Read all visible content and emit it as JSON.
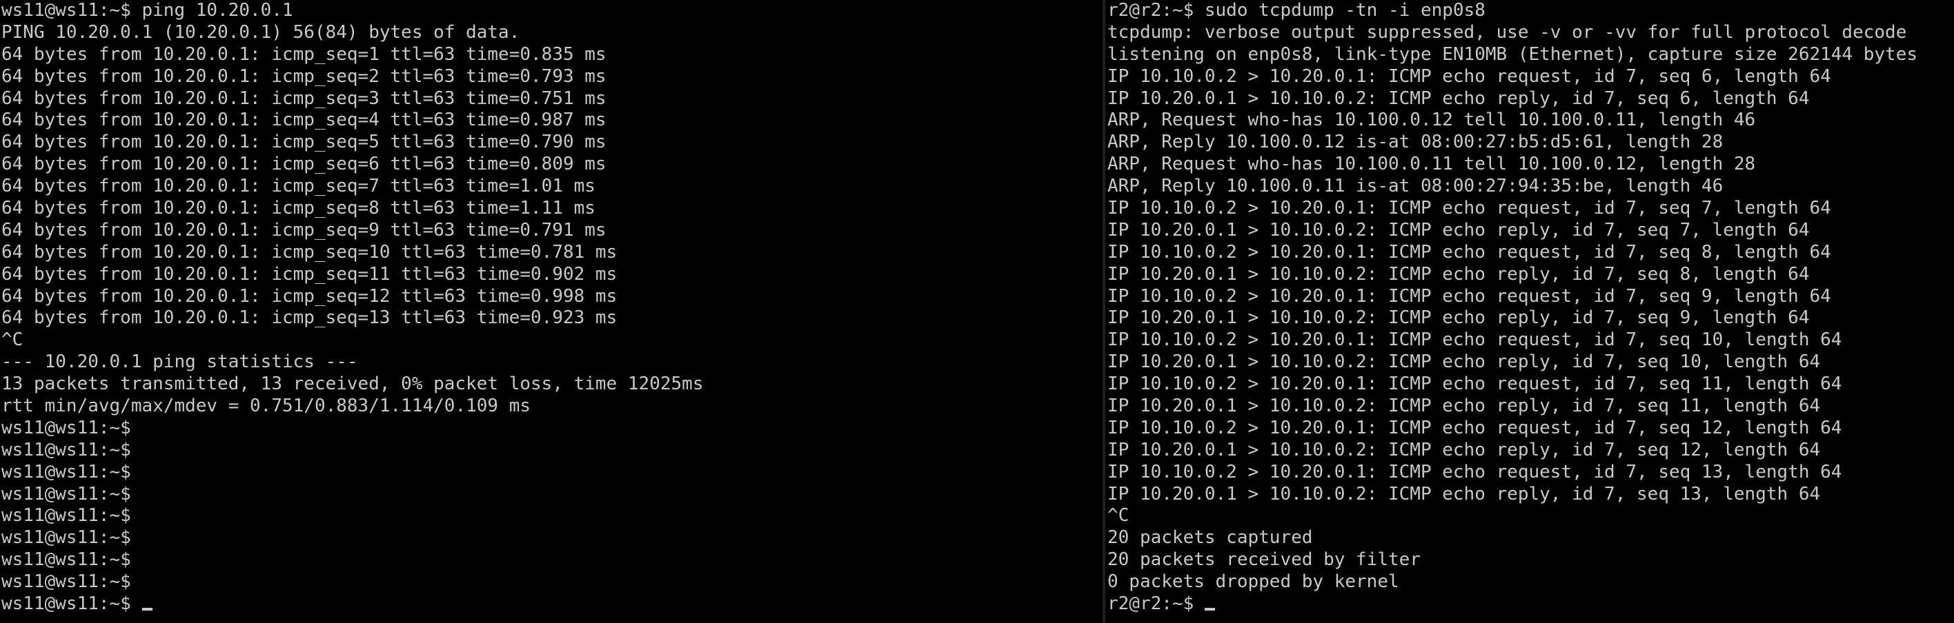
{
  "colors": {
    "background": "#000000",
    "text": "#c8c8c8",
    "divider": "#202020"
  },
  "left_terminal": {
    "lines": [
      "ws11@ws11:~$ ping 10.20.0.1",
      "PING 10.20.0.1 (10.20.0.1) 56(84) bytes of data.",
      "64 bytes from 10.20.0.1: icmp_seq=1 ttl=63 time=0.835 ms",
      "64 bytes from 10.20.0.1: icmp_seq=2 ttl=63 time=0.793 ms",
      "64 bytes from 10.20.0.1: icmp_seq=3 ttl=63 time=0.751 ms",
      "64 bytes from 10.20.0.1: icmp_seq=4 ttl=63 time=0.987 ms",
      "64 bytes from 10.20.0.1: icmp_seq=5 ttl=63 time=0.790 ms",
      "64 bytes from 10.20.0.1: icmp_seq=6 ttl=63 time=0.809 ms",
      "64 bytes from 10.20.0.1: icmp_seq=7 ttl=63 time=1.01 ms",
      "64 bytes from 10.20.0.1: icmp_seq=8 ttl=63 time=1.11 ms",
      "64 bytes from 10.20.0.1: icmp_seq=9 ttl=63 time=0.791 ms",
      "64 bytes from 10.20.0.1: icmp_seq=10 ttl=63 time=0.781 ms",
      "64 bytes from 10.20.0.1: icmp_seq=11 ttl=63 time=0.902 ms",
      "64 bytes from 10.20.0.1: icmp_seq=12 ttl=63 time=0.998 ms",
      "64 bytes from 10.20.0.1: icmp_seq=13 ttl=63 time=0.923 ms",
      "^C",
      "--- 10.20.0.1 ping statistics ---",
      "13 packets transmitted, 13 received, 0% packet loss, time 12025ms",
      "rtt min/avg/max/mdev = 0.751/0.883/1.114/0.109 ms",
      "ws11@ws11:~$",
      "ws11@ws11:~$",
      "ws11@ws11:~$",
      "ws11@ws11:~$",
      "ws11@ws11:~$",
      "ws11@ws11:~$",
      "ws11@ws11:~$",
      "ws11@ws11:~$"
    ],
    "prompt": "ws11@ws11:~$ "
  },
  "right_terminal": {
    "lines": [
      "r2@r2:~$ sudo tcpdump -tn -i enp0s8",
      "tcpdump: verbose output suppressed, use -v or -vv for full protocol decode",
      "listening on enp0s8, link-type EN10MB (Ethernet), capture size 262144 bytes",
      "IP 10.10.0.2 > 10.20.0.1: ICMP echo request, id 7, seq 6, length 64",
      "IP 10.20.0.1 > 10.10.0.2: ICMP echo reply, id 7, seq 6, length 64",
      "ARP, Request who-has 10.100.0.12 tell 10.100.0.11, length 46",
      "ARP, Reply 10.100.0.12 is-at 08:00:27:b5:d5:61, length 28",
      "ARP, Request who-has 10.100.0.11 tell 10.100.0.12, length 28",
      "ARP, Reply 10.100.0.11 is-at 08:00:27:94:35:be, length 46",
      "IP 10.10.0.2 > 10.20.0.1: ICMP echo request, id 7, seq 7, length 64",
      "IP 10.20.0.1 > 10.10.0.2: ICMP echo reply, id 7, seq 7, length 64",
      "IP 10.10.0.2 > 10.20.0.1: ICMP echo request, id 7, seq 8, length 64",
      "IP 10.20.0.1 > 10.10.0.2: ICMP echo reply, id 7, seq 8, length 64",
      "IP 10.10.0.2 > 10.20.0.1: ICMP echo request, id 7, seq 9, length 64",
      "IP 10.20.0.1 > 10.10.0.2: ICMP echo reply, id 7, seq 9, length 64",
      "IP 10.10.0.2 > 10.20.0.1: ICMP echo request, id 7, seq 10, length 64",
      "IP 10.20.0.1 > 10.10.0.2: ICMP echo reply, id 7, seq 10, length 64",
      "IP 10.10.0.2 > 10.20.0.1: ICMP echo request, id 7, seq 11, length 64",
      "IP 10.20.0.1 > 10.10.0.2: ICMP echo reply, id 7, seq 11, length 64",
      "IP 10.10.0.2 > 10.20.0.1: ICMP echo request, id 7, seq 12, length 64",
      "IP 10.20.0.1 > 10.10.0.2: ICMP echo reply, id 7, seq 12, length 64",
      "IP 10.10.0.2 > 10.20.0.1: ICMP echo request, id 7, seq 13, length 64",
      "IP 10.20.0.1 > 10.10.0.2: ICMP echo reply, id 7, seq 13, length 64",
      "^C",
      "20 packets captured",
      "20 packets received by filter",
      "0 packets dropped by kernel"
    ],
    "prompt": "r2@r2:~$ "
  }
}
